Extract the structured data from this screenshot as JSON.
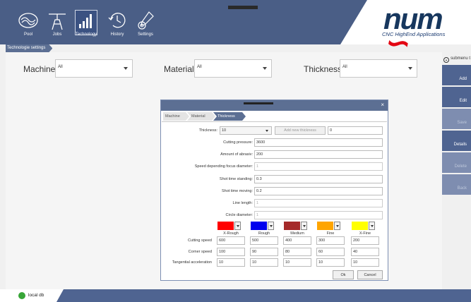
{
  "header": {
    "nav": [
      {
        "label": "Pool",
        "icon": "pool-icon"
      },
      {
        "label": "Jobs",
        "icon": "jobs-icon"
      },
      {
        "label": "Technology",
        "icon": "technology-icon"
      },
      {
        "label": "History",
        "icon": "history-icon"
      },
      {
        "label": "Settings",
        "icon": "settings-icon"
      }
    ],
    "active_nav": "Technology",
    "logo_text": "num",
    "logo_tagline": "CNC HighEnd Applications"
  },
  "breadcrumb": "Technologie settings",
  "filters": {
    "machine_label": "Machine",
    "machine_value": "All",
    "material_label": "Material",
    "material_value": "All",
    "thickness_label": "Thickness",
    "thickness_value": "All"
  },
  "sidebar": {
    "submenu_label": "submenu t",
    "buttons": [
      {
        "label": "Add",
        "enabled": true
      },
      {
        "label": "Edit",
        "enabled": true
      },
      {
        "label": "Save",
        "enabled": false
      },
      {
        "label": "Details",
        "enabled": true
      },
      {
        "label": "Delete",
        "enabled": false
      },
      {
        "label": "Back",
        "enabled": false
      }
    ]
  },
  "footer": {
    "db_label": "local db"
  },
  "dialog": {
    "close_glyph": "×",
    "wizard": [
      "Machine",
      "Material",
      "Thickness"
    ],
    "thickness_label": "Thickness:",
    "thickness_value": "10",
    "add_thickness_label": "Add new thickness",
    "new_thickness_value": "0",
    "fields": [
      {
        "label": "Cutting pressure:",
        "value": "3600",
        "disabled": false
      },
      {
        "label": "Amount of abrasiv:",
        "value": "200",
        "disabled": false
      },
      {
        "label": "Speed depending focus diameter:",
        "value": "1",
        "disabled": true
      },
      {
        "label": "Shot time standing:",
        "value": "0.3",
        "disabled": false
      },
      {
        "label": "Shot time moving:",
        "value": "0.2",
        "disabled": false
      },
      {
        "label": "Line length:",
        "value": "1",
        "disabled": true
      },
      {
        "label": "Circle diameter:",
        "value": "1",
        "disabled": true
      }
    ],
    "qualities": [
      {
        "name": "X-Rough",
        "color": "#ff0000"
      },
      {
        "name": "Rough",
        "color": "#0000ee"
      },
      {
        "name": "Medium",
        "color": "#a52a2a"
      },
      {
        "name": "Fine",
        "color": "#ffa500"
      },
      {
        "name": "X-Fine",
        "color": "#ffff00"
      }
    ],
    "rows": [
      {
        "label": "Cutting speed",
        "values": [
          "600",
          "500",
          "400",
          "300",
          "200"
        ]
      },
      {
        "label": "Corner speed",
        "values": [
          "100",
          "90",
          "80",
          "60",
          "40"
        ]
      },
      {
        "label": "Tangential acceleration",
        "values": [
          "10",
          "10",
          "10",
          "10",
          "10"
        ]
      }
    ],
    "ok_label": "Ok",
    "cancel_label": "Cancel"
  }
}
